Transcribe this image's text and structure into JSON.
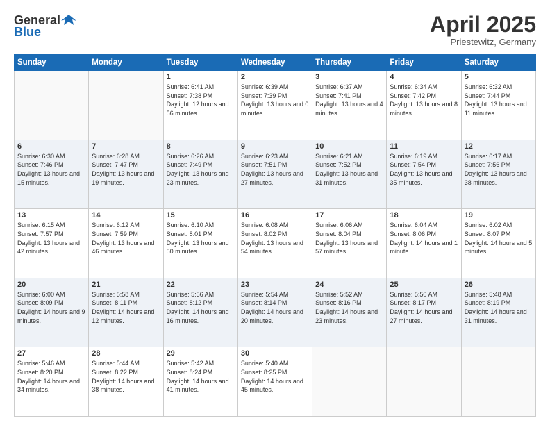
{
  "header": {
    "logo_general": "General",
    "logo_blue": "Blue",
    "month_title": "April 2025",
    "subtitle": "Priestewitz, Germany"
  },
  "days_of_week": [
    "Sunday",
    "Monday",
    "Tuesday",
    "Wednesday",
    "Thursday",
    "Friday",
    "Saturday"
  ],
  "weeks": [
    [
      {
        "day": "",
        "sunrise": "",
        "sunset": "",
        "daylight": ""
      },
      {
        "day": "",
        "sunrise": "",
        "sunset": "",
        "daylight": ""
      },
      {
        "day": "1",
        "sunrise": "Sunrise: 6:41 AM",
        "sunset": "Sunset: 7:38 PM",
        "daylight": "Daylight: 12 hours and 56 minutes."
      },
      {
        "day": "2",
        "sunrise": "Sunrise: 6:39 AM",
        "sunset": "Sunset: 7:39 PM",
        "daylight": "Daylight: 13 hours and 0 minutes."
      },
      {
        "day": "3",
        "sunrise": "Sunrise: 6:37 AM",
        "sunset": "Sunset: 7:41 PM",
        "daylight": "Daylight: 13 hours and 4 minutes."
      },
      {
        "day": "4",
        "sunrise": "Sunrise: 6:34 AM",
        "sunset": "Sunset: 7:42 PM",
        "daylight": "Daylight: 13 hours and 8 minutes."
      },
      {
        "day": "5",
        "sunrise": "Sunrise: 6:32 AM",
        "sunset": "Sunset: 7:44 PM",
        "daylight": "Daylight: 13 hours and 11 minutes."
      }
    ],
    [
      {
        "day": "6",
        "sunrise": "Sunrise: 6:30 AM",
        "sunset": "Sunset: 7:46 PM",
        "daylight": "Daylight: 13 hours and 15 minutes."
      },
      {
        "day": "7",
        "sunrise": "Sunrise: 6:28 AM",
        "sunset": "Sunset: 7:47 PM",
        "daylight": "Daylight: 13 hours and 19 minutes."
      },
      {
        "day": "8",
        "sunrise": "Sunrise: 6:26 AM",
        "sunset": "Sunset: 7:49 PM",
        "daylight": "Daylight: 13 hours and 23 minutes."
      },
      {
        "day": "9",
        "sunrise": "Sunrise: 6:23 AM",
        "sunset": "Sunset: 7:51 PM",
        "daylight": "Daylight: 13 hours and 27 minutes."
      },
      {
        "day": "10",
        "sunrise": "Sunrise: 6:21 AM",
        "sunset": "Sunset: 7:52 PM",
        "daylight": "Daylight: 13 hours and 31 minutes."
      },
      {
        "day": "11",
        "sunrise": "Sunrise: 6:19 AM",
        "sunset": "Sunset: 7:54 PM",
        "daylight": "Daylight: 13 hours and 35 minutes."
      },
      {
        "day": "12",
        "sunrise": "Sunrise: 6:17 AM",
        "sunset": "Sunset: 7:56 PM",
        "daylight": "Daylight: 13 hours and 38 minutes."
      }
    ],
    [
      {
        "day": "13",
        "sunrise": "Sunrise: 6:15 AM",
        "sunset": "Sunset: 7:57 PM",
        "daylight": "Daylight: 13 hours and 42 minutes."
      },
      {
        "day": "14",
        "sunrise": "Sunrise: 6:12 AM",
        "sunset": "Sunset: 7:59 PM",
        "daylight": "Daylight: 13 hours and 46 minutes."
      },
      {
        "day": "15",
        "sunrise": "Sunrise: 6:10 AM",
        "sunset": "Sunset: 8:01 PM",
        "daylight": "Daylight: 13 hours and 50 minutes."
      },
      {
        "day": "16",
        "sunrise": "Sunrise: 6:08 AM",
        "sunset": "Sunset: 8:02 PM",
        "daylight": "Daylight: 13 hours and 54 minutes."
      },
      {
        "day": "17",
        "sunrise": "Sunrise: 6:06 AM",
        "sunset": "Sunset: 8:04 PM",
        "daylight": "Daylight: 13 hours and 57 minutes."
      },
      {
        "day": "18",
        "sunrise": "Sunrise: 6:04 AM",
        "sunset": "Sunset: 8:06 PM",
        "daylight": "Daylight: 14 hours and 1 minute."
      },
      {
        "day": "19",
        "sunrise": "Sunrise: 6:02 AM",
        "sunset": "Sunset: 8:07 PM",
        "daylight": "Daylight: 14 hours and 5 minutes."
      }
    ],
    [
      {
        "day": "20",
        "sunrise": "Sunrise: 6:00 AM",
        "sunset": "Sunset: 8:09 PM",
        "daylight": "Daylight: 14 hours and 9 minutes."
      },
      {
        "day": "21",
        "sunrise": "Sunrise: 5:58 AM",
        "sunset": "Sunset: 8:11 PM",
        "daylight": "Daylight: 14 hours and 12 minutes."
      },
      {
        "day": "22",
        "sunrise": "Sunrise: 5:56 AM",
        "sunset": "Sunset: 8:12 PM",
        "daylight": "Daylight: 14 hours and 16 minutes."
      },
      {
        "day": "23",
        "sunrise": "Sunrise: 5:54 AM",
        "sunset": "Sunset: 8:14 PM",
        "daylight": "Daylight: 14 hours and 20 minutes."
      },
      {
        "day": "24",
        "sunrise": "Sunrise: 5:52 AM",
        "sunset": "Sunset: 8:16 PM",
        "daylight": "Daylight: 14 hours and 23 minutes."
      },
      {
        "day": "25",
        "sunrise": "Sunrise: 5:50 AM",
        "sunset": "Sunset: 8:17 PM",
        "daylight": "Daylight: 14 hours and 27 minutes."
      },
      {
        "day": "26",
        "sunrise": "Sunrise: 5:48 AM",
        "sunset": "Sunset: 8:19 PM",
        "daylight": "Daylight: 14 hours and 31 minutes."
      }
    ],
    [
      {
        "day": "27",
        "sunrise": "Sunrise: 5:46 AM",
        "sunset": "Sunset: 8:20 PM",
        "daylight": "Daylight: 14 hours and 34 minutes."
      },
      {
        "day": "28",
        "sunrise": "Sunrise: 5:44 AM",
        "sunset": "Sunset: 8:22 PM",
        "daylight": "Daylight: 14 hours and 38 minutes."
      },
      {
        "day": "29",
        "sunrise": "Sunrise: 5:42 AM",
        "sunset": "Sunset: 8:24 PM",
        "daylight": "Daylight: 14 hours and 41 minutes."
      },
      {
        "day": "30",
        "sunrise": "Sunrise: 5:40 AM",
        "sunset": "Sunset: 8:25 PM",
        "daylight": "Daylight: 14 hours and 45 minutes."
      },
      {
        "day": "",
        "sunrise": "",
        "sunset": "",
        "daylight": ""
      },
      {
        "day": "",
        "sunrise": "",
        "sunset": "",
        "daylight": ""
      },
      {
        "day": "",
        "sunrise": "",
        "sunset": "",
        "daylight": ""
      }
    ]
  ],
  "colors": {
    "header_bg": "#1a6bb5",
    "alt_row_bg": "#eef2f7",
    "empty_bg": "#f5f5f5"
  }
}
